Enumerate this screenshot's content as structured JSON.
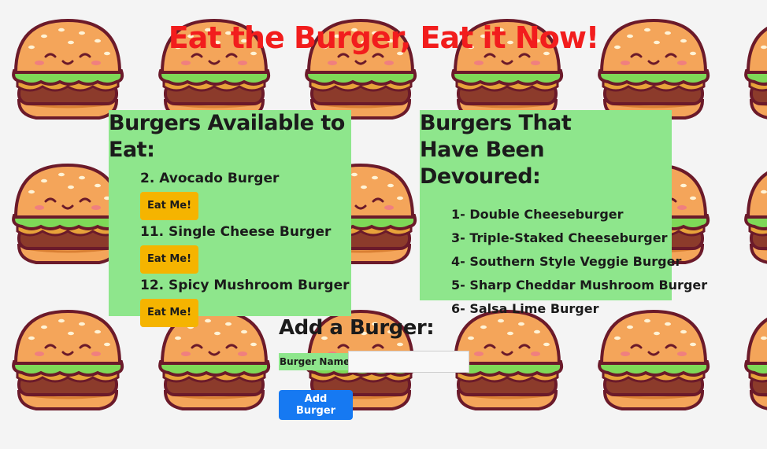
{
  "page": {
    "title": "Eat the Burger, Eat it Now!"
  },
  "available": {
    "heading": "Burgers Available to Eat:",
    "items": [
      {
        "label": "2. Avocado Burger",
        "button": "Eat Me!"
      },
      {
        "label": "11. Single Cheese Burger",
        "button": "Eat Me!"
      },
      {
        "label": "12. Spicy Mushroom Burger",
        "button": "Eat Me!"
      }
    ]
  },
  "devoured": {
    "heading": "Burgers That Have Been Devoured:",
    "items": [
      "1- Double Cheeseburger",
      "3- Triple-Staked Cheeseburger",
      "4- Southern Style Veggie Burger",
      "5- Sharp Cheddar Mushroom Burger",
      "6- Salsa Lime Burger"
    ]
  },
  "form": {
    "heading": "Add a Burger:",
    "name_label": "Burger Name:",
    "name_value": "",
    "submit_label": "Add Burger"
  },
  "colors": {
    "title": "#f21d1d",
    "panel": "#8ee68c",
    "eat_button": "#f5b400",
    "add_button": "#1679f2",
    "background": "#f4f4f4"
  },
  "background_pattern": {
    "icon": "burger-icon"
  }
}
